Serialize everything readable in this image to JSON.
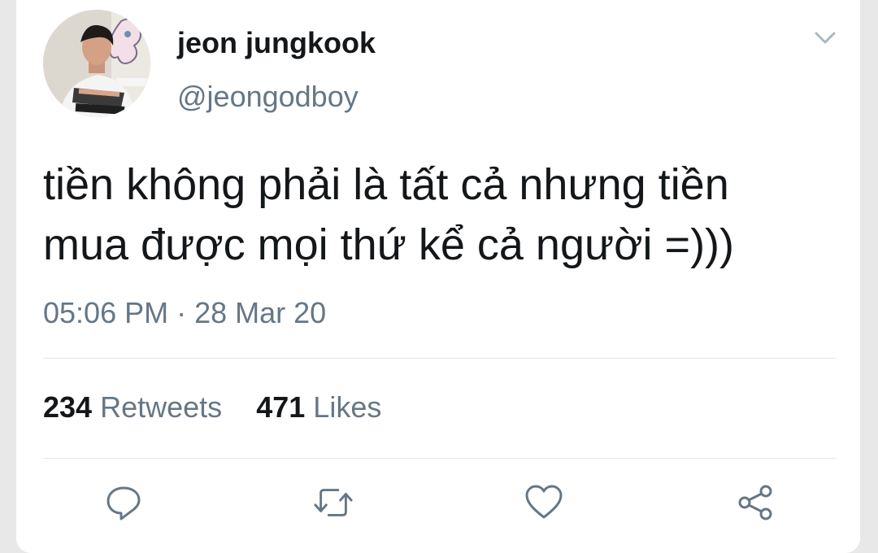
{
  "tweet": {
    "display_name": "jeon jungkook",
    "handle": "@jeongodboy",
    "text_line1": "tiền không phải là tất cả nhưng tiền",
    "text_line2": "mua được mọi thứ kể cả người =)))",
    "timestamp": "05:06 PM · 28 Mar 20"
  },
  "stats": {
    "retweets_count": "234",
    "retweets_label": "Retweets",
    "likes_count": "471",
    "likes_label": "Likes"
  },
  "icons": {
    "menu": "chevron-down-icon",
    "reply": "reply-icon",
    "retweet": "retweet-icon",
    "like": "heart-icon",
    "share": "share-icon"
  },
  "colors": {
    "text_primary": "#14171a",
    "text_secondary": "#657786",
    "icon": "#657786",
    "divider": "#e1e8ed"
  }
}
